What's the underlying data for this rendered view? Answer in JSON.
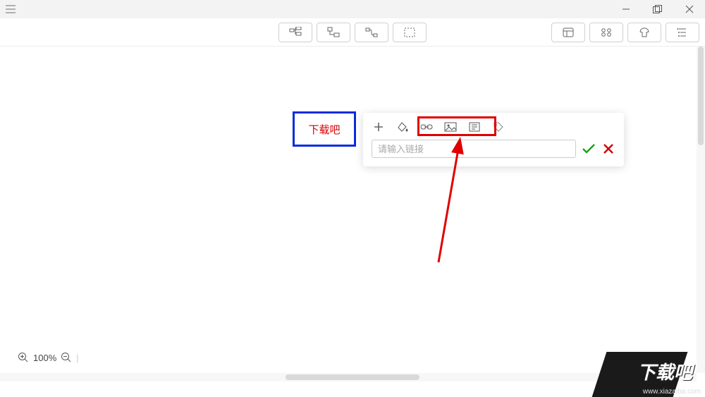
{
  "node": {
    "label": "下载吧"
  },
  "linkPopover": {
    "placeholder": "请输入链接",
    "value": ""
  },
  "zoom": {
    "level": "100%"
  },
  "watermark": {
    "brand": "下载吧",
    "url": "www.xiazaiba.com"
  },
  "icons": {
    "menu": "menu-icon",
    "minimize": "minimize-icon",
    "maximize": "maximize-icon",
    "close": "close-icon"
  }
}
